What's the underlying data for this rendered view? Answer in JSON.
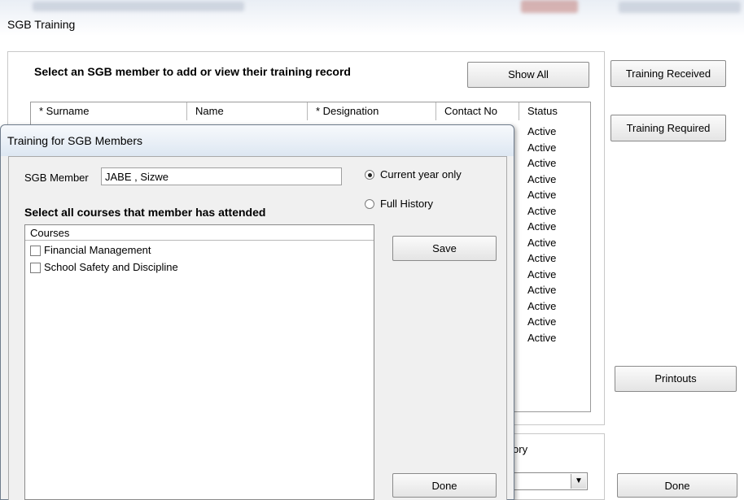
{
  "window": {
    "title": "SGB Training"
  },
  "main": {
    "instruction": "Select an SGB member to add or view their training record",
    "show_all_label": "Show All",
    "columns": [
      "* Surname",
      "Name",
      "* Designation",
      "Contact No",
      "Status"
    ],
    "status_values": [
      "Active",
      "Active",
      "Active",
      "Active",
      "Active",
      "Active",
      "Active",
      "Active",
      "Active",
      "Active",
      "Active",
      "Active",
      "Active",
      "Active"
    ],
    "category_label": "by Category"
  },
  "side": {
    "training_received": "Training Received",
    "training_required": "Training Required",
    "printouts": "Printouts",
    "done": "Done"
  },
  "dialog": {
    "title": "Training for SGB Members",
    "member_label": "SGB Member",
    "member_value": "JABE , Sizwe",
    "radio_current": "Current year only",
    "radio_full": "Full History",
    "select_courses_label": "Select all courses that member has attended",
    "courses_header": "Courses",
    "courses": [
      {
        "label": "Financial Management",
        "checked": false
      },
      {
        "label": "School Safety and Discipline",
        "checked": false
      }
    ],
    "save_label": "Save",
    "done_label": "Done"
  }
}
